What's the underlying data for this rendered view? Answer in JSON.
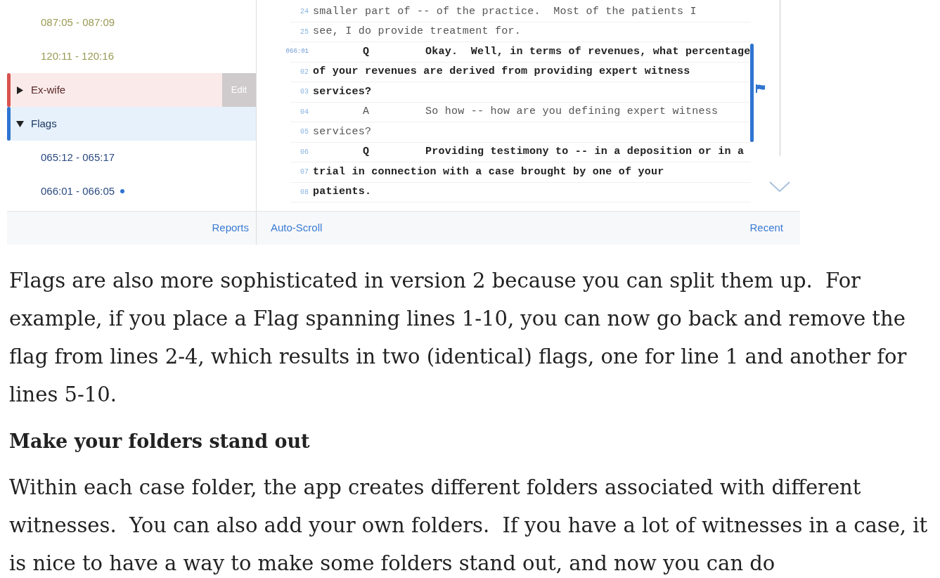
{
  "sidebar": {
    "items": [
      {
        "kind": "range",
        "label": "087:05 - 087:09",
        "color": "#9a9a55"
      },
      {
        "kind": "range",
        "label": "120:11 - 120:16",
        "color": "#9a9a55"
      },
      {
        "kind": "folder",
        "label": "Ex-wife",
        "color": "#d9534f",
        "expanded": false,
        "selected": false,
        "action": "Edit"
      },
      {
        "kind": "folder",
        "label": "Flags",
        "color": "#2f74d0",
        "expanded": true,
        "selected": true,
        "children": [
          {
            "label": "065:12 - 065:17",
            "current": false
          },
          {
            "label": "066:01 - 066:05",
            "current": true
          }
        ]
      }
    ],
    "footer_link": "Reports"
  },
  "transcript": {
    "lines": [
      {
        "number": "24",
        "text": "smaller part of -- of the practice.  Most of the patients I",
        "bold": false,
        "page_start": false
      },
      {
        "number": "25",
        "text": "see, I do provide treatment for.",
        "bold": false,
        "page_start": false
      },
      {
        "number": "066:01",
        "speaker": "Q",
        "text": "Okay.  Well, in terms of revenues, what percentage",
        "bold": true,
        "page_start": true
      },
      {
        "number": "02",
        "text": "of your revenues are derived from providing expert witness",
        "bold": true,
        "page_start": false
      },
      {
        "number": "03",
        "text": "services?",
        "bold": true,
        "page_start": false
      },
      {
        "number": "04",
        "speaker": "A",
        "text": "So how -- how are you defining expert witness",
        "bold": false,
        "page_start": false
      },
      {
        "number": "05",
        "text": "services?",
        "bold": false,
        "page_start": false
      },
      {
        "number": "06",
        "speaker": "Q",
        "text": "Providing testimony to -- in a deposition or in a",
        "bold": true,
        "page_start": false
      },
      {
        "number": "07",
        "text": "trial in connection with a case brought by one of your",
        "bold": true,
        "page_start": false
      },
      {
        "number": "08",
        "text": "patients.",
        "bold": true,
        "page_start": false
      }
    ],
    "footer_left": "Auto-Scroll",
    "footer_right": "Recent"
  },
  "article": [
    {
      "kind": "paragraph",
      "text": "Flags are also more sophisticated in version 2 because you can split them up.  For example, if you place a Flag spanning lines 1-10, you can now go back and remove the flag from lines 2-4, which results in two (identical) flags, one for line 1 and another for lines 5-10."
    },
    {
      "kind": "heading",
      "text": "Make your folders stand out"
    },
    {
      "kind": "paragraph",
      "text": "Within each case folder, the app creates different folders associated with different witnesses.  You can also add your own folders.  If you have a lot of witnesses in a case, it is nice to have a way to make some folders stand out, and now you can do"
    }
  ]
}
